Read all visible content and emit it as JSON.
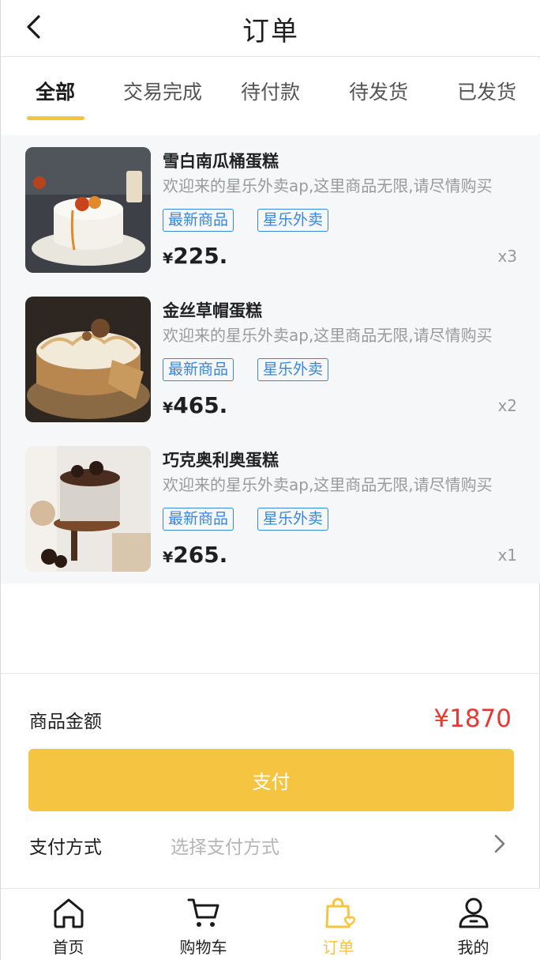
{
  "header": {
    "title": "订单"
  },
  "tabs": [
    {
      "label": "全部",
      "active": true
    },
    {
      "label": "交易完成",
      "active": false
    },
    {
      "label": "待付款",
      "active": false
    },
    {
      "label": "待发货",
      "active": false
    },
    {
      "label": "已发货",
      "active": false
    }
  ],
  "orders": [
    {
      "name": "雪白南瓜桶蛋糕",
      "desc": "欢迎来的星乐外卖ap,这里商品无限,请尽情购买",
      "tags": [
        "最新商品",
        "星乐外卖"
      ],
      "currency": "¥",
      "price": "225.",
      "qty": "x3"
    },
    {
      "name": "金丝草帽蛋糕",
      "desc": "欢迎来的星乐外卖ap,这里商品无限,请尽情购买",
      "tags": [
        "最新商品",
        "星乐外卖"
      ],
      "currency": "¥",
      "price": "465.",
      "qty": "x2"
    },
    {
      "name": "巧克奥利奥蛋糕",
      "desc": "欢迎来的星乐外卖ap,这里商品无限,请尽情购买",
      "tags": [
        "最新商品",
        "星乐外卖"
      ],
      "currency": "¥",
      "price": "265.",
      "qty": "x1"
    }
  ],
  "summary": {
    "amount_label": "商品金额",
    "amount_value": "¥1870",
    "pay_button": "支付",
    "pay_method_label": "支付方式",
    "pay_method_placeholder": "选择支付方式"
  },
  "bottom_nav": [
    {
      "label": "首页",
      "icon": "home-icon",
      "active": false
    },
    {
      "label": "购物车",
      "icon": "cart-icon",
      "active": false
    },
    {
      "label": "订单",
      "icon": "order-bag-icon",
      "active": true
    },
    {
      "label": "我的",
      "icon": "user-icon",
      "active": false
    }
  ],
  "colors": {
    "accent": "#f5c542",
    "price_red": "#e53935",
    "tag_blue": "#3a86d8"
  }
}
